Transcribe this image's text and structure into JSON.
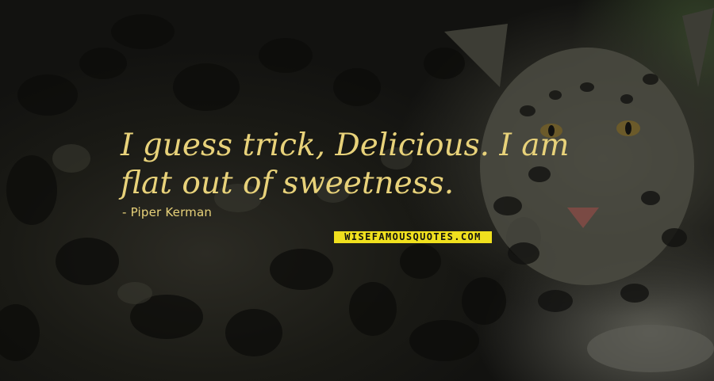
{
  "quote": {
    "text": "I guess trick, Delicious. I am flat out of sweetness.",
    "author": "- Piper Kerman"
  },
  "watermark": {
    "label": "WISEFAMOUSQUOTES.COM"
  },
  "colors": {
    "text": "#e8d27a",
    "watermark_bg": "#f0e01e",
    "background": "#151511"
  }
}
